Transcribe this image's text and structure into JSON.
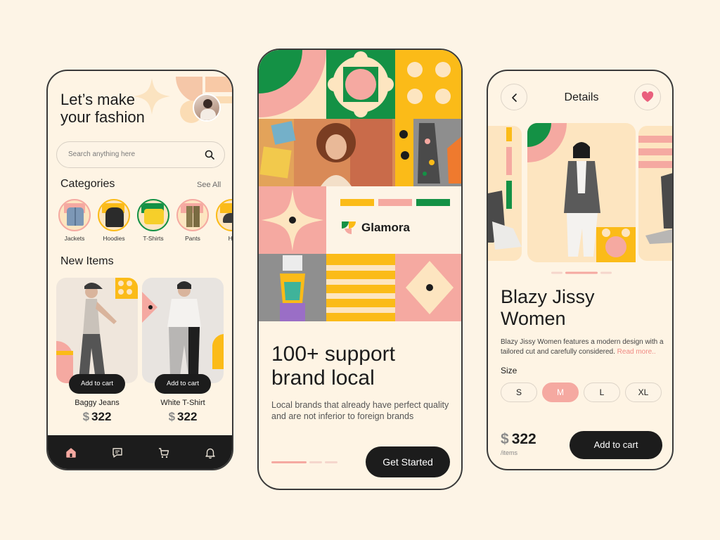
{
  "colors": {
    "background": "#fdf4e6",
    "pink": "#f5a9a1",
    "yellow": "#fbbb18",
    "green": "#149145",
    "cream": "#fde5c0",
    "dark": "#1c1c1c"
  },
  "home": {
    "title_line1": "Let’s make",
    "title_line2": "your fashion",
    "search": {
      "placeholder": "Search anything here",
      "icon": "search-icon"
    },
    "categories": {
      "title": "Categories",
      "see_all": "See All",
      "items": [
        {
          "label": "Jackets"
        },
        {
          "label": "Hoodies"
        },
        {
          "label": "T-Shirts"
        },
        {
          "label": "Pants"
        },
        {
          "label": "Ha"
        }
      ]
    },
    "new_items": {
      "title": "New Items",
      "items": [
        {
          "name": "Baggy Jeans",
          "currency": "$",
          "price": "322",
          "button": "Add to cart"
        },
        {
          "name": "White T-Shirt",
          "currency": "$",
          "price": "322",
          "button": "Add to cart"
        }
      ]
    },
    "tabbar": [
      {
        "icon": "home-icon",
        "active": true
      },
      {
        "icon": "chat-icon",
        "active": false
      },
      {
        "icon": "cart-icon",
        "active": false
      },
      {
        "icon": "bell-icon",
        "active": false
      }
    ]
  },
  "onboarding": {
    "brand": "Glamora",
    "headline_line1": "100+ support",
    "headline_line2": "brand local",
    "subtitle": "Local brands that already have perfect quality and are not inferior to foreign brands",
    "button": "Get Started",
    "pagination": {
      "pages": 3,
      "active": 1
    }
  },
  "details": {
    "header_title": "Details",
    "back_icon": "chevron-left-icon",
    "favorite_icon": "heart-icon",
    "product_line1": "Blazy Jissy",
    "product_line2": "Women",
    "description": "Blazy Jissy Women features a modern design with a tailored cut and carefully considered.",
    "read_more": "Read more..",
    "size_label": "Size",
    "sizes": [
      "S",
      "M",
      "L",
      "XL"
    ],
    "selected_size": "M",
    "currency": "$",
    "price": "322",
    "unit": "/items",
    "button": "Add to cart",
    "carousel": {
      "pages": 3,
      "active": 1
    }
  }
}
